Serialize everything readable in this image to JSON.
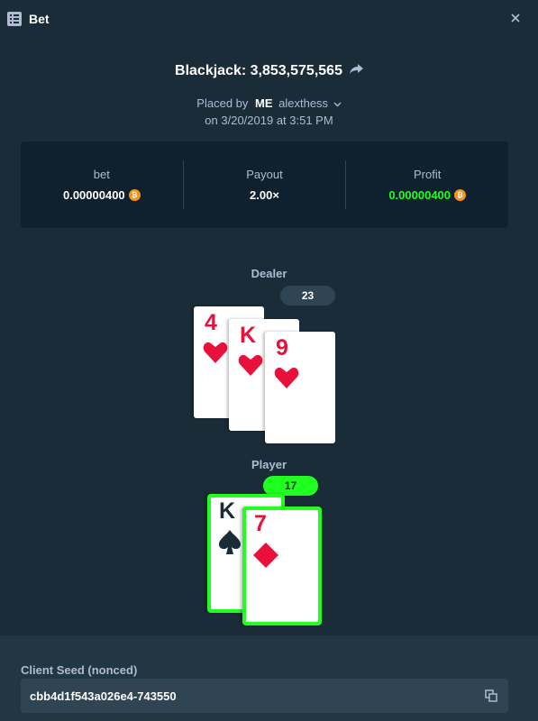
{
  "header": {
    "title": "Bet",
    "icon": "bet-slip-icon"
  },
  "bet": {
    "title": "Blackjack: 3,853,575,565",
    "placed_prefix": "Placed by",
    "me_label": "ME",
    "username": "alexthess",
    "date": "on 3/20/2019 at 3:51 PM"
  },
  "stats": {
    "bet_label": "bet",
    "bet_value": "0.00000400",
    "payout_label": "Payout",
    "payout_value": "2.00×",
    "profit_label": "Profit",
    "profit_value": "0.00000400",
    "currency_icon": "bitcoin-icon",
    "currency_symbol": "₿"
  },
  "dealer": {
    "label": "Dealer",
    "score": "23",
    "cards": [
      {
        "rank": "4",
        "suit": "hearts"
      },
      {
        "rank": "K",
        "suit": "hearts"
      },
      {
        "rank": "9",
        "suit": "hearts"
      }
    ]
  },
  "player": {
    "label": "Player",
    "score": "17",
    "cards": [
      {
        "rank": "K",
        "suit": "spades"
      },
      {
        "rank": "7",
        "suit": "diamonds"
      }
    ]
  },
  "seed": {
    "label": "Client Seed (nonced)",
    "value": "cbb4d1f543a026e4-743550"
  },
  "colors": {
    "background": "#1a2c38",
    "panel": "#0f212e",
    "win": "#1fff20",
    "red_suit": "#e9113c"
  }
}
